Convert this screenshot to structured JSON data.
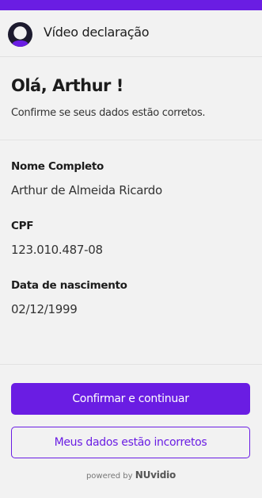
{
  "header": {
    "title": "Vídeo declaração",
    "avatar_icon": "user-avatar-icon"
  },
  "intro": {
    "greeting": "Olá, Arthur !",
    "subtitle": "Confirme se seus dados estão corretos."
  },
  "fields": [
    {
      "label": "Nome Completo",
      "value": "Arthur de Almeida Ricardo"
    },
    {
      "label": "CPF",
      "value": "123.010.487-08"
    },
    {
      "label": "Data de nascimento",
      "value": "02/12/1999"
    }
  ],
  "actions": {
    "confirm_label": "Confirmar e continuar",
    "incorrect_label": "Meus dados estão incorretos"
  },
  "footer": {
    "powered_by": "powered by",
    "brand": "NUvidio"
  },
  "colors": {
    "accent": "#6a1de3",
    "background": "#f2f2f2",
    "text": "#1c1c1c"
  }
}
